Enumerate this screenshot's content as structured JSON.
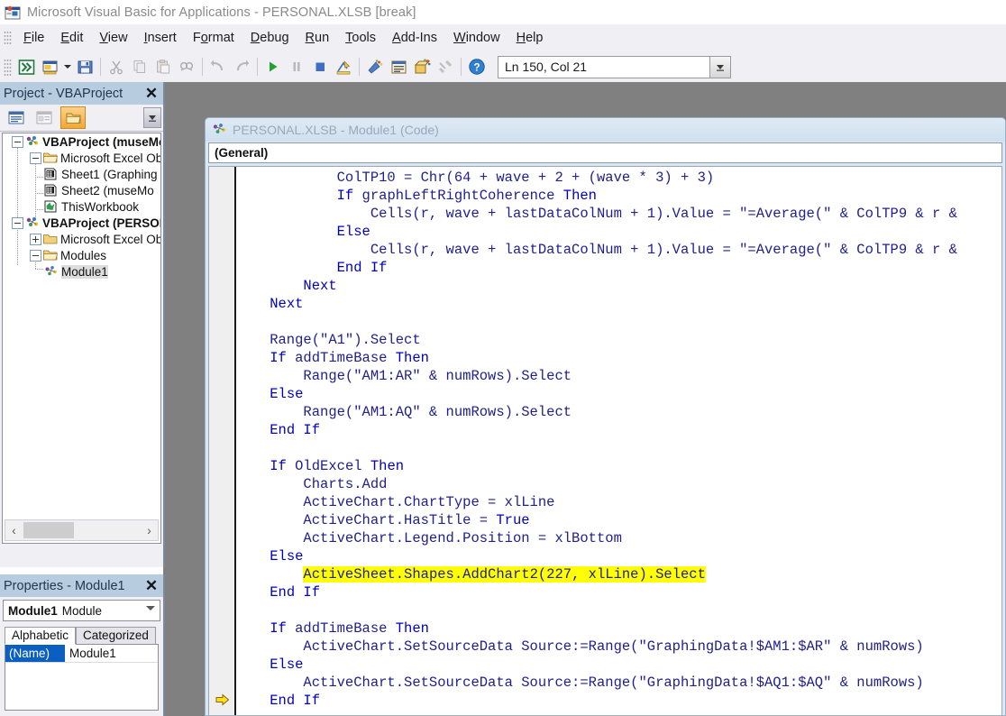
{
  "window": {
    "title": "Microsoft Visual Basic for Applications - PERSONAL.XLSB [break]",
    "app_icon": "vba-app-icon"
  },
  "menubar": {
    "items": [
      {
        "label": "File",
        "accel": "F"
      },
      {
        "label": "Edit",
        "accel": "E"
      },
      {
        "label": "View",
        "accel": "V"
      },
      {
        "label": "Insert",
        "accel": "I"
      },
      {
        "label": "Format",
        "accel": "o"
      },
      {
        "label": "Debug",
        "accel": "D"
      },
      {
        "label": "Run",
        "accel": "R"
      },
      {
        "label": "Tools",
        "accel": "T"
      },
      {
        "label": "Add-Ins",
        "accel": "A"
      },
      {
        "label": "Window",
        "accel": "W"
      },
      {
        "label": "Help",
        "accel": "H"
      }
    ]
  },
  "toolbar": {
    "buttons": [
      {
        "name": "view-excel-icon",
        "tip": "View Microsoft Excel"
      },
      {
        "name": "insert-userform-icon",
        "tip": "Insert UserForm"
      },
      {
        "name": "insert-dropdown-icon",
        "tip": "Insert dropdown"
      },
      {
        "name": "save-icon",
        "tip": "Save PERSONAL.XLSB"
      },
      {
        "name": "cut-icon",
        "tip": "Cut"
      },
      {
        "name": "copy-icon",
        "tip": "Copy"
      },
      {
        "name": "paste-icon",
        "tip": "Paste"
      },
      {
        "name": "find-icon",
        "tip": "Find"
      },
      {
        "name": "undo-icon",
        "tip": "Undo"
      },
      {
        "name": "redo-icon",
        "tip": "Redo"
      },
      {
        "name": "run-icon",
        "tip": "Run Sub/UserForm"
      },
      {
        "name": "pause-icon",
        "tip": "Break"
      },
      {
        "name": "stop-icon",
        "tip": "Reset"
      },
      {
        "name": "design-mode-icon",
        "tip": "Design Mode"
      },
      {
        "name": "project-explorer-icon",
        "tip": "Project Explorer"
      },
      {
        "name": "properties-window-icon",
        "tip": "Properties Window"
      },
      {
        "name": "object-browser-icon",
        "tip": "Object Browser"
      },
      {
        "name": "toolbox-icon",
        "tip": "Toolbox"
      },
      {
        "name": "help-icon",
        "tip": "Help"
      }
    ],
    "position_indicator": "Ln 150, Col 21"
  },
  "project_panel": {
    "caption": "Project - VBAProject",
    "close_label": "✕",
    "toolbar_buttons": [
      {
        "name": "view-code-icon"
      },
      {
        "name": "view-object-icon"
      },
      {
        "name": "toggle-folders-icon"
      }
    ],
    "tree": [
      {
        "label": "VBAProject (museMo",
        "icon": "vba-project-icon",
        "depth": 0,
        "expander": "minus",
        "bold": true,
        "selected": false
      },
      {
        "label": "Microsoft Excel Obje",
        "icon": "folder-open-icon",
        "depth": 1,
        "expander": "minus",
        "bold": false,
        "selected": false
      },
      {
        "label": "Sheet1 (Graphing",
        "icon": "worksheet-icon",
        "depth": 2,
        "expander": "none",
        "bold": false,
        "selected": false
      },
      {
        "label": "Sheet2 (museMo",
        "icon": "worksheet-icon",
        "depth": 2,
        "expander": "none",
        "bold": false,
        "selected": false
      },
      {
        "label": "ThisWorkbook",
        "icon": "workbook-icon",
        "depth": 2,
        "expander": "none",
        "bold": false,
        "selected": false
      },
      {
        "label": "VBAProject (PERSON",
        "icon": "vba-project-icon",
        "depth": 0,
        "expander": "minus",
        "bold": true,
        "selected": false
      },
      {
        "label": "Microsoft Excel Obje",
        "icon": "folder-closed-icon",
        "depth": 1,
        "expander": "plus",
        "bold": false,
        "selected": false
      },
      {
        "label": "Modules",
        "icon": "folder-open-icon",
        "depth": 1,
        "expander": "minus",
        "bold": false,
        "selected": false
      },
      {
        "label": "Module1",
        "icon": "module-icon",
        "depth": 2,
        "expander": "none",
        "bold": false,
        "selected": true
      }
    ],
    "scrollbar": {
      "left_arrow": "‹",
      "right_arrow": "›"
    }
  },
  "properties_panel": {
    "caption": "Properties - Module1",
    "close_label": "✕",
    "object_name": "Module1",
    "object_type": "Module",
    "tabs": [
      {
        "label": "Alphabetic",
        "active": true
      },
      {
        "label": "Categorized",
        "active": false
      }
    ],
    "rows": [
      {
        "key": "(Name)",
        "value": "Module1"
      }
    ]
  },
  "code_window": {
    "title": "PERSONAL.XLSB - Module1 (Code)",
    "icon": "module-icon",
    "object_combo": "(General)",
    "procedure_combo": "",
    "execution_marker": "⇨",
    "marker_line_index": 30,
    "highlight_color": "#ffff00",
    "keyword_color": "#0000c0",
    "text_color": "#20208f",
    "lines": [
      {
        "segments": [
          {
            "t": "            ColTP10 = Chr(64 + wave + 2 + (wave * 3) + 3)",
            "k": false
          }
        ]
      },
      {
        "segments": [
          {
            "t": "            ",
            "k": false
          },
          {
            "t": "If",
            "k": true
          },
          {
            "t": " graphLeftRightCoherence ",
            "k": false
          },
          {
            "t": "Then",
            "k": true
          }
        ]
      },
      {
        "segments": [
          {
            "t": "                Cells(r, wave + lastDataColNum + 1).Value = \"=Average(\" & ColTP9 & r &",
            "k": false
          }
        ]
      },
      {
        "segments": [
          {
            "t": "            ",
            "k": false
          },
          {
            "t": "Else",
            "k": true
          }
        ]
      },
      {
        "segments": [
          {
            "t": "                Cells(r, wave + lastDataColNum + 1).Value = \"=Average(\" & ColTP9 & r &",
            "k": false
          }
        ]
      },
      {
        "segments": [
          {
            "t": "            ",
            "k": false
          },
          {
            "t": "End If",
            "k": true
          }
        ]
      },
      {
        "segments": [
          {
            "t": "        ",
            "k": false
          },
          {
            "t": "Next",
            "k": true
          }
        ]
      },
      {
        "segments": [
          {
            "t": "    ",
            "k": false
          },
          {
            "t": "Next",
            "k": true
          }
        ]
      },
      {
        "segments": [
          {
            "t": "",
            "k": false
          }
        ]
      },
      {
        "segments": [
          {
            "t": "    Range(\"A1\").Select",
            "k": false
          }
        ]
      },
      {
        "segments": [
          {
            "t": "    ",
            "k": false
          },
          {
            "t": "If",
            "k": true
          },
          {
            "t": " addTimeBase ",
            "k": false
          },
          {
            "t": "Then",
            "k": true
          }
        ]
      },
      {
        "segments": [
          {
            "t": "        Range(\"AM1:AR\" & numRows).Select",
            "k": false
          }
        ]
      },
      {
        "segments": [
          {
            "t": "    ",
            "k": false
          },
          {
            "t": "Else",
            "k": true
          }
        ]
      },
      {
        "segments": [
          {
            "t": "        Range(\"AM1:AQ\" & numRows).Select",
            "k": false
          }
        ]
      },
      {
        "segments": [
          {
            "t": "    ",
            "k": false
          },
          {
            "t": "End If",
            "k": true
          }
        ]
      },
      {
        "segments": [
          {
            "t": "",
            "k": false
          }
        ]
      },
      {
        "segments": [
          {
            "t": "    ",
            "k": false
          },
          {
            "t": "If",
            "k": true
          },
          {
            "t": " OldExcel ",
            "k": false
          },
          {
            "t": "Then",
            "k": true
          }
        ]
      },
      {
        "segments": [
          {
            "t": "        Charts.Add",
            "k": false
          }
        ]
      },
      {
        "segments": [
          {
            "t": "        ActiveChart.ChartType = xlLine",
            "k": false
          }
        ]
      },
      {
        "segments": [
          {
            "t": "        ActiveChart.HasTitle = ",
            "k": false
          },
          {
            "t": "True",
            "k": true
          }
        ]
      },
      {
        "segments": [
          {
            "t": "        ActiveChart.Legend.Position = xlBottom",
            "k": false
          }
        ]
      },
      {
        "segments": [
          {
            "t": "    ",
            "k": false
          },
          {
            "t": "Else",
            "k": true
          }
        ]
      },
      {
        "segments": [
          {
            "t": "        ",
            "k": false
          },
          {
            "t": "ActiveSheet.Shapes.AddChart2(227, xlLine).Select",
            "k": false,
            "h": true
          }
        ]
      },
      {
        "segments": [
          {
            "t": "    ",
            "k": false
          },
          {
            "t": "End If",
            "k": true
          }
        ]
      },
      {
        "segments": [
          {
            "t": "",
            "k": false
          }
        ]
      },
      {
        "segments": [
          {
            "t": "    ",
            "k": false
          },
          {
            "t": "If",
            "k": true
          },
          {
            "t": " addTimeBase ",
            "k": false
          },
          {
            "t": "Then",
            "k": true
          }
        ]
      },
      {
        "segments": [
          {
            "t": "        ActiveChart.SetSourceData Source:=Range(\"GraphingData!$AM1:$AR\" & numRows)",
            "k": false
          }
        ]
      },
      {
        "segments": [
          {
            "t": "    ",
            "k": false
          },
          {
            "t": "Else",
            "k": true
          }
        ]
      },
      {
        "segments": [
          {
            "t": "        ActiveChart.SetSourceData Source:=Range(\"GraphingData!$AQ1:$AQ\" & numRows)",
            "k": false
          }
        ]
      },
      {
        "segments": [
          {
            "t": "    ",
            "k": false
          },
          {
            "t": "End If",
            "k": true
          }
        ]
      }
    ]
  }
}
